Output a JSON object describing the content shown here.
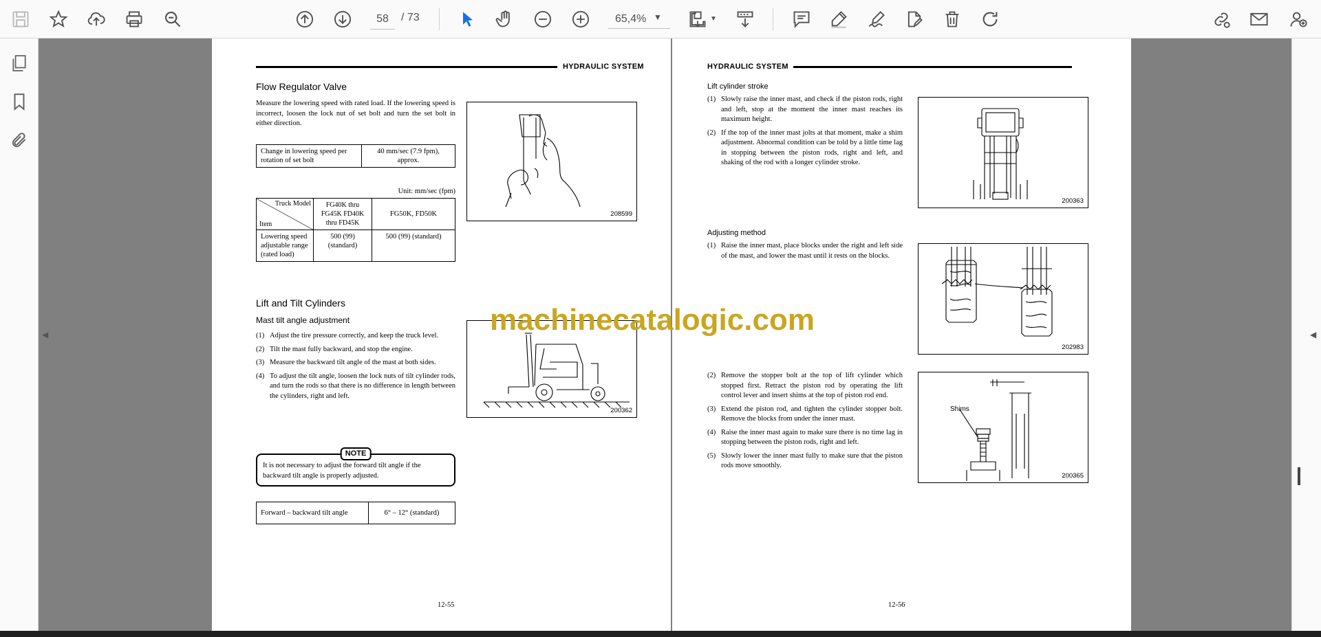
{
  "toolbar": {
    "page_current": "58",
    "page_total": "/ 73",
    "zoom": "65,4%",
    "icons": [
      "save-icon",
      "bookmark-star-icon",
      "upload-icon",
      "print-icon",
      "search-zoom-icon",
      "page-up-icon",
      "page-down-icon",
      "zoom-out-icon",
      "zoom-in-icon",
      "select-arrow-icon",
      "hand-icon",
      "page-fit-icon",
      "scroll-mode-icon",
      "comment-icon",
      "highlight-pen-icon",
      "signature-icon",
      "edit-pdf-icon",
      "delete-icon",
      "rotate-icon",
      "share-link-icon",
      "mail-icon",
      "add-user-icon"
    ]
  },
  "left_panel": {
    "icons": [
      "pages-icon",
      "bookmark-icon",
      "attachment-icon"
    ]
  },
  "watermark": "machinecatalogic.com",
  "page_left": {
    "header": "HYDRAULIC SYSTEM",
    "flow_title": "Flow Regulator Valve",
    "flow_para": "Measure the lowering speed with rated load.  If the lowering speed is incorrect, loosen the lock nut of set bolt and turn the set bolt in either direction.",
    "table1": {
      "label": "Change in lowering speed per rotation of set bolt",
      "value": "40 mm/sec (7.9 fpm), approx."
    },
    "unit": "Unit:  mm/sec (fpm)",
    "table2": {
      "corner_top": "Truck Model",
      "corner_bottom": "Item",
      "col1": "FG40K thru FG45K FD40K thru FD45K",
      "col2": "FG50K, FD50K",
      "row_label": "Lowering speed adjustable range (rated load)",
      "v1": "500 (99) (standard)",
      "v2": "500 (99) (standard)"
    },
    "fig1_id": "208599",
    "lift_title": "Lift and Tilt Cylinders",
    "mast_title": "Mast tilt angle adjustment",
    "steps": [
      {
        "n": "(1)",
        "t": "Adjust the tire pressure correctly, and keep the truck level."
      },
      {
        "n": "(2)",
        "t": "Tilt the mast fully backward, and stop the engine."
      },
      {
        "n": "(3)",
        "t": "Measure the backward tilt angle of the mast at both sides."
      },
      {
        "n": "(4)",
        "t": "To adjust the tilt angle, loosen the lock nuts of tilt cylinder rods, and turn the rods so that there is no difference in length between the cylinders, right and left."
      }
    ],
    "fig2_id": "200362",
    "note_label": "NOTE",
    "note_text": "It is not necessary to adjust the forward tilt angle if the backward tilt angle is properly adjusted.",
    "table3": {
      "label": "Forward – backward tilt angle",
      "value": "6° – 12° (standard)"
    },
    "page_number": "12-55"
  },
  "page_right": {
    "header": "HYDRAULIC SYSTEM",
    "stroke_title": "Lift cylinder stroke",
    "stroke_steps": [
      {
        "n": "(1)",
        "t": "Slowly raise the inner mast, and check if the piston rods, right and left, stop at the moment the inner mast reaches its maximum height."
      },
      {
        "n": "(2)",
        "t": "If the top of the inner mast jolts at that moment, make a shim adjustment.  Abnormal condition can be told by a little time lag in stopping between the piston rods, right and left, and shaking of the rod with a longer cylinder stroke."
      }
    ],
    "fig3_id": "200363",
    "adj_title": "Adjusting method",
    "adj_steps1": [
      {
        "n": "(1)",
        "t": "Raise the inner mast, place blocks under the right and left side of the mast, and lower the mast until it rests on the blocks."
      }
    ],
    "fig4_id": "202983",
    "adj_steps2": [
      {
        "n": "(2)",
        "t": "Remove the stopper bolt at the top of lift cylinder which stopped first.  Retract the piston rod by operating the lift control lever and insert shims at the top of piston rod end."
      },
      {
        "n": "(3)",
        "t": "Extend the piston rod, and tighten the cylinder stopper bolt.  Remove the blocks from under the inner mast."
      },
      {
        "n": "(4)",
        "t": "Raise the inner mast again to make sure there is no time lag in stopping between the piston rods, right and left."
      },
      {
        "n": "(5)",
        "t": "Slowly lower the inner mast fully to make sure that the piston rods move smoothly."
      }
    ],
    "fig5_label": "Shims",
    "fig5_id": "200365",
    "page_number": "12-56"
  }
}
